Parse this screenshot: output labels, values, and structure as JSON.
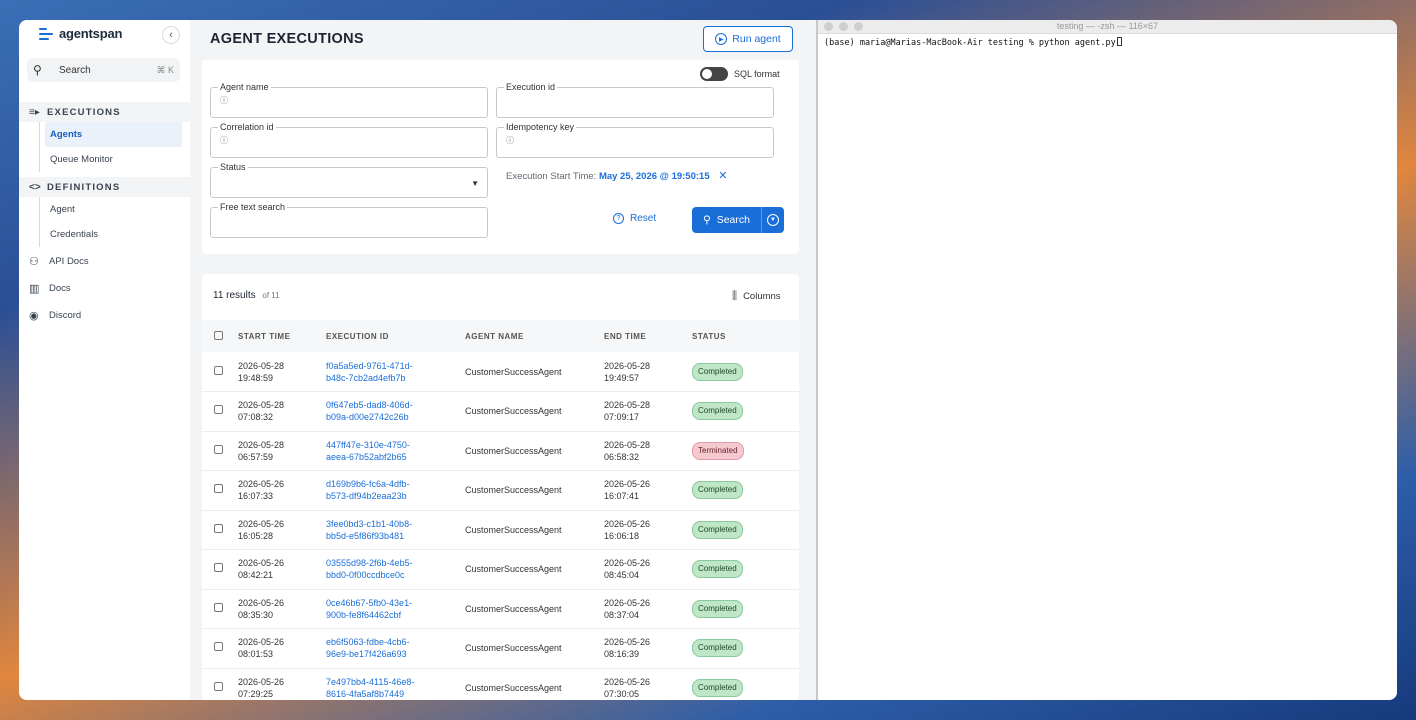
{
  "sidebar": {
    "logo": "agentspan",
    "search_label": "Search",
    "search_shortcut": "⌘ K",
    "sections": [
      {
        "label": "EXECUTIONS",
        "items": [
          "Agents",
          "Queue Monitor"
        ]
      },
      {
        "label": "DEFINITIONS",
        "items": [
          "Agent",
          "Credentials"
        ]
      }
    ],
    "links": [
      "API Docs",
      "Docs",
      "Discord"
    ]
  },
  "header": {
    "title": "AGENT EXECUTIONS",
    "run_agent": "Run agent"
  },
  "filters": {
    "agent_name": "Agent name",
    "execution_id": "Execution id",
    "correlation_id": "Correlation id",
    "idempotency_key": "Idempotency key",
    "status": "Status",
    "free_text": "Free text search",
    "sql_format": "SQL format",
    "exec_start_label": "Execution Start Time:",
    "exec_start_value": "May 25, 2026 @ 19:50:15",
    "reset": "Reset",
    "search": "Search"
  },
  "results": {
    "count": "11 results",
    "of": "of 11",
    "columns": "Columns",
    "headers": [
      "START TIME",
      "EXECUTION ID",
      "AGENT NAME",
      "END TIME",
      "STATUS"
    ],
    "rows": [
      {
        "start_date": "2026-05-28",
        "start_time": "19:48:59",
        "id1": "f0a5a5ed-9761-471d-",
        "id2": "b48c-7cb2ad4efb7b",
        "agent": "CustomerSuccessAgent",
        "end_date": "2026-05-28",
        "end_time": "19:49:57",
        "status": "Completed"
      },
      {
        "start_date": "2026-05-28",
        "start_time": "07:08:32",
        "id1": "0f647eb5-dad8-406d-",
        "id2": "b09a-d00e2742c26b",
        "agent": "CustomerSuccessAgent",
        "end_date": "2026-05-28",
        "end_time": "07:09:17",
        "status": "Completed"
      },
      {
        "start_date": "2026-05-28",
        "start_time": "06:57:59",
        "id1": "447ff47e-310e-4750-",
        "id2": "aeea-67b52abf2b65",
        "agent": "CustomerSuccessAgent",
        "end_date": "2026-05-28",
        "end_time": "06:58:32",
        "status": "Terminated"
      },
      {
        "start_date": "2026-05-26",
        "start_time": "16:07:33",
        "id1": "d169b9b6-fc6a-4dfb-",
        "id2": "b573-df94b2eaa23b",
        "agent": "CustomerSuccessAgent",
        "end_date": "2026-05-26",
        "end_time": "16:07:41",
        "status": "Completed"
      },
      {
        "start_date": "2026-05-26",
        "start_time": "16:05:28",
        "id1": "3fee0bd3-c1b1-40b8-",
        "id2": "bb5d-e5f86f93b481",
        "agent": "CustomerSuccessAgent",
        "end_date": "2026-05-26",
        "end_time": "16:06:18",
        "status": "Completed"
      },
      {
        "start_date": "2026-05-26",
        "start_time": "08:42:21",
        "id1": "03555d98-2f6b-4eb5-",
        "id2": "bbd0-0f00ccdbce0c",
        "agent": "CustomerSuccessAgent",
        "end_date": "2026-05-26",
        "end_time": "08:45:04",
        "status": "Completed"
      },
      {
        "start_date": "2026-05-26",
        "start_time": "08:35:30",
        "id1": "0ce46b67-5fb0-43e1-",
        "id2": "900b-fe8f64462cbf",
        "agent": "CustomerSuccessAgent",
        "end_date": "2026-05-26",
        "end_time": "08:37:04",
        "status": "Completed"
      },
      {
        "start_date": "2026-05-26",
        "start_time": "08:01:53",
        "id1": "eb6f5063-fdbe-4cb6-",
        "id2": "96e9-be17f426a693",
        "agent": "CustomerSuccessAgent",
        "end_date": "2026-05-26",
        "end_time": "08:16:39",
        "status": "Completed"
      },
      {
        "start_date": "2026-05-26",
        "start_time": "07:29:25",
        "id1": "7e497bb4-4115-46e8-",
        "id2": "8616-4fa5af8b7449",
        "agent": "CustomerSuccessAgent",
        "end_date": "2026-05-26",
        "end_time": "07:30:05",
        "status": "Completed"
      }
    ]
  },
  "terminal": {
    "title": "testing — -zsh — 116×67",
    "line": "(base) maria@Marias-MacBook-Air testing % python agent.py"
  },
  "colors": {
    "accent": "#1a6ed8",
    "completed": "#bfe6c6",
    "terminated": "#f4c9cf"
  }
}
